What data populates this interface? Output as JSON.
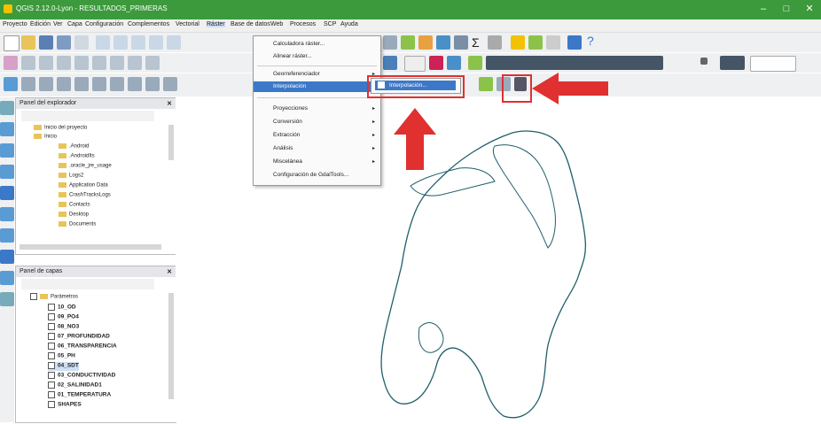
{
  "window": {
    "title": "QGIS 2.12.0-Lyon - RESULTADOS_PRIMERAS",
    "minimize": "–",
    "maximize": "□",
    "close": "✕"
  },
  "menubar": [
    "Proyecto",
    "Edición",
    "Ver",
    "Capa",
    "Configuración",
    "Complementos",
    "Vectorial",
    "Ráster",
    "Base de datos",
    "Web",
    "Procesos",
    "SCP",
    "Ayuda"
  ],
  "raster_menu": {
    "items": [
      {
        "label": "Calculadora ráster...",
        "arrow": ""
      },
      {
        "label": "Alinear ráster...",
        "arrow": ""
      },
      {
        "label": "Georreferenciador",
        "arrow": "▸"
      },
      {
        "label": "Interpolación",
        "arrow": "▸",
        "highlighted": true
      },
      {
        "label": "Proyecciones",
        "arrow": "▸"
      },
      {
        "label": "Conversión",
        "arrow": "▸"
      },
      {
        "label": "Extracción",
        "arrow": "▸"
      },
      {
        "label": "Análisis",
        "arrow": "▸"
      },
      {
        "label": "Miscelánea",
        "arrow": "▸"
      },
      {
        "label": "Configuración de GdalTools..."
      }
    ],
    "submenu": {
      "label": "Interpolación..."
    }
  },
  "explorer_panel": {
    "title": "Panel del explorador",
    "close": "✕",
    "items": [
      "Inicio del proyecto",
      "Inicio",
      ".Android",
      ".AndroidIts",
      ".oracle_jre_usage",
      "Logs2",
      "Application Data",
      "CrashTracksLogs",
      "Contacts",
      "Desktop",
      "Documents"
    ]
  },
  "layers_panel": {
    "title": "Panel de capas",
    "close": "✕",
    "group": "Parámetros",
    "layers": [
      "10_OD",
      "09_PO4",
      "08_NO3",
      "07_PROFUNDIDAD",
      "06_TRANSPARENCIA",
      "05_PH",
      "04_SDT",
      "03_CONDUCTIVIDAD",
      "02_SALINIDAD1",
      "01_TEMPERATURA",
      "SHAPES"
    ]
  },
  "toolbar": {
    "sigma": "Σ",
    "help": "?"
  },
  "colors": {
    "titlebar": "#3c9a3c",
    "highlight": "#3c78c8",
    "annotation_red": "#e03030",
    "map_outline": "#1f5f6a"
  }
}
